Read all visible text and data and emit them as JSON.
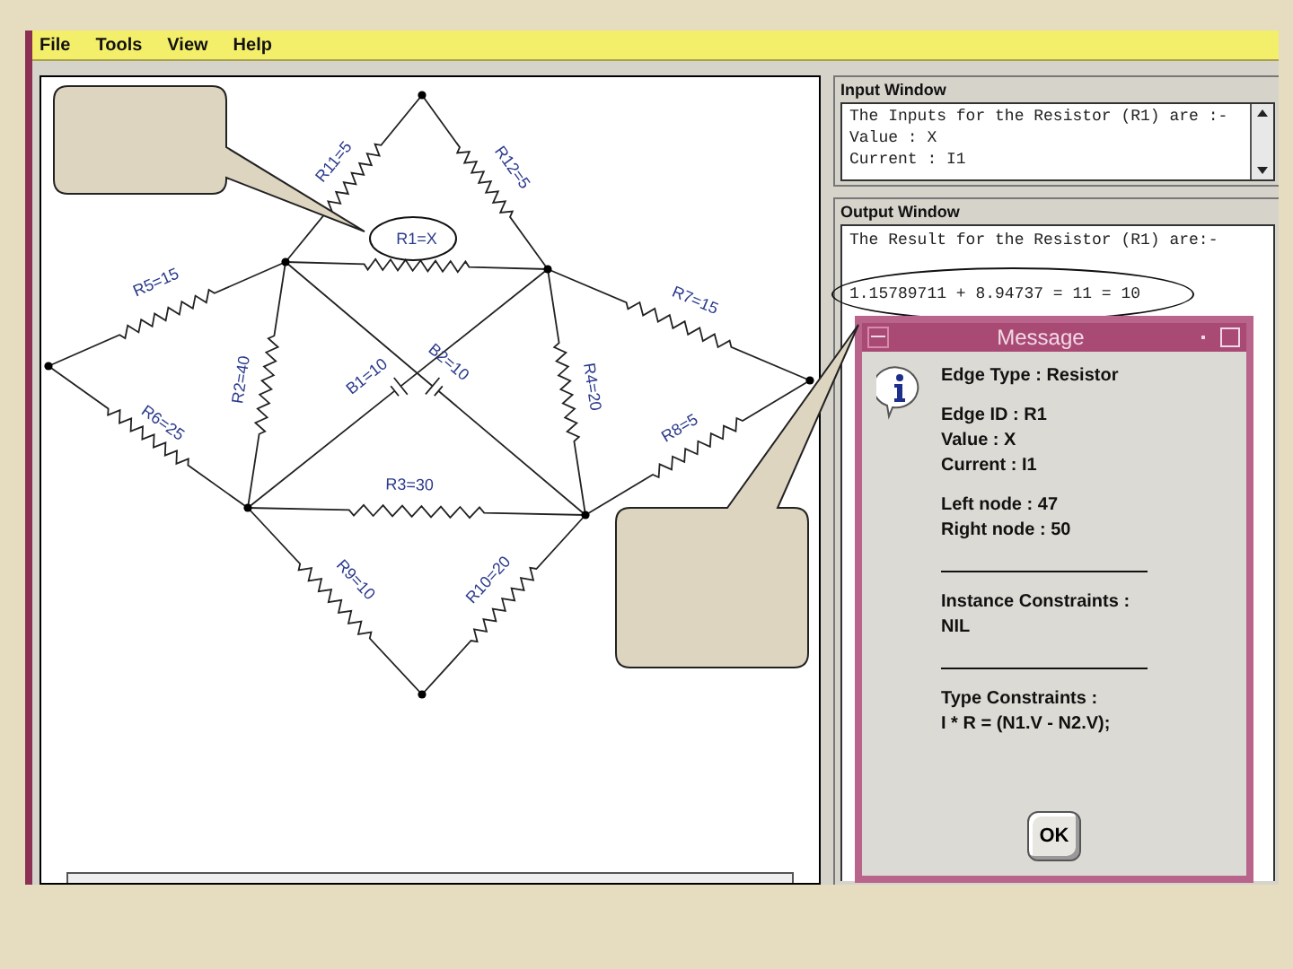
{
  "menu": [
    {
      "label": "File"
    },
    {
      "label": "Tools"
    },
    {
      "label": "View"
    },
    {
      "label": "Help"
    }
  ],
  "circuit": {
    "edges": [
      {
        "kind": "resistor",
        "label": "R11=5",
        "circled": false
      },
      {
        "kind": "resistor",
        "label": "R12=5",
        "circled": false
      },
      {
        "kind": "resistor",
        "label": "R1=X",
        "circled": true
      },
      {
        "kind": "resistor",
        "label": "R5=15",
        "circled": false
      },
      {
        "kind": "resistor",
        "label": "R7=15",
        "circled": false
      },
      {
        "kind": "resistor",
        "label": "R6=25",
        "circled": false
      },
      {
        "kind": "resistor",
        "label": "R8=5",
        "circled": false
      },
      {
        "kind": "resistor",
        "label": "R2=40",
        "circled": false
      },
      {
        "kind": "resistor",
        "label": "R4=20",
        "circled": false
      },
      {
        "kind": "battery",
        "label": "B1=10",
        "circled": false
      },
      {
        "kind": "battery",
        "label": "B2=10",
        "circled": false
      },
      {
        "kind": "resistor",
        "label": "R3=30",
        "circled": false
      },
      {
        "kind": "resistor",
        "label": "R9=10",
        "circled": false
      },
      {
        "kind": "resistor",
        "label": "R10=20",
        "circled": false
      }
    ]
  },
  "input_window": {
    "title": "Input Window",
    "lines": [
      "The Inputs for the Resistor (R1) are :-",
      "Value : X",
      "Current : I1"
    ]
  },
  "output_window": {
    "title": "Output Window",
    "lines": [
      {
        "text": "The Result for the Resistor (R1) are:-",
        "circled": false
      },
      {
        "text": "1.15789711 + 8.94737 = 11 = 10",
        "circled": true
      }
    ]
  },
  "message": {
    "title": "Message",
    "blocks": [
      {
        "kind": "text",
        "lines": [
          "Edge Type : Resistor"
        ]
      },
      {
        "kind": "text",
        "lines": [
          "Edge ID : R1",
          "Value : X",
          "Current : I1"
        ]
      },
      {
        "kind": "text",
        "lines": [
          "Left node : 47",
          "Right node : 50"
        ]
      },
      {
        "kind": "rule"
      },
      {
        "kind": "text",
        "lines": [
          "Instance Constraints :",
          "NIL"
        ]
      },
      {
        "kind": "rule"
      },
      {
        "kind": "text",
        "lines": [
          "Type Constraints :",
          "I * R = (N1.V - N2.V);"
        ]
      }
    ],
    "button": "OK"
  }
}
